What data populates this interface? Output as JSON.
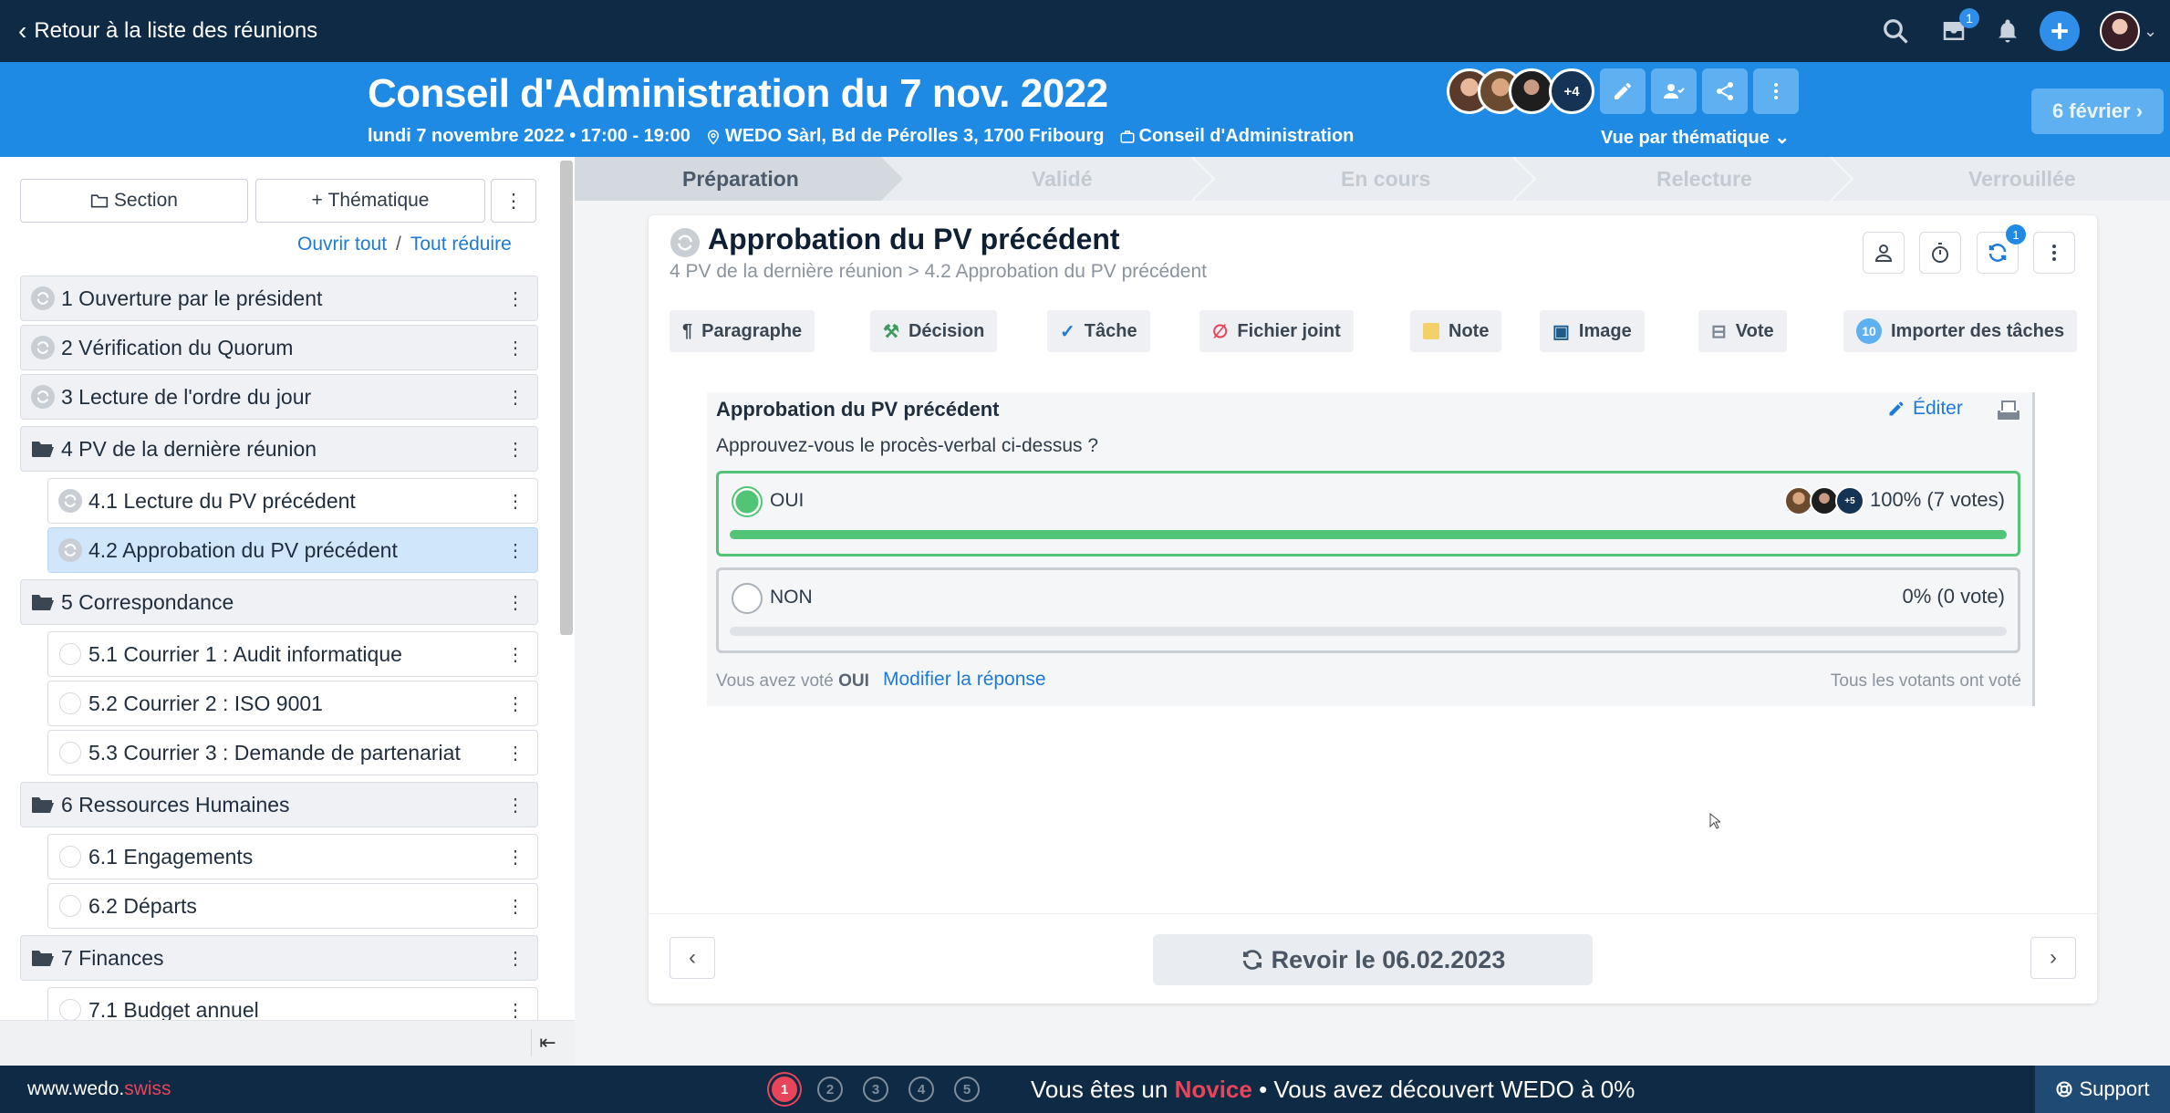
{
  "topbar": {
    "back_label": "Retour à la liste des réunions",
    "inbox_badge": "1"
  },
  "header": {
    "title": "Conseil d'Administration du 7 nov. 2022",
    "date_time": "lundi 7 novembre 2022 • 17:00 - 19:00",
    "location": "WEDO Sàrl, Bd de Pérolles 3, 1700 Fribourg",
    "group": "Conseil d'Administration",
    "extra_attendees": "+4",
    "view_mode": "Vue par thématique",
    "next_meeting": "6 février"
  },
  "sidebar": {
    "section_button": "Section",
    "theme_button": "Thématique",
    "open_all": "Ouvrir tout",
    "separator": "/",
    "collapse_all": "Tout réduire",
    "items": [
      {
        "label": "1 Ouverture par le président",
        "level": 1,
        "icon": "sync-icon"
      },
      {
        "label": "2 Vérification du Quorum",
        "level": 1,
        "icon": "sync-icon"
      },
      {
        "label": "3 Lecture de l'ordre du jour",
        "level": 1,
        "icon": "sync-icon"
      },
      {
        "label": "4 PV de la dernière réunion",
        "level": 1,
        "icon": "folder-open-icon"
      },
      {
        "label": "4.1 Lecture du PV précédent",
        "level": 2,
        "icon": "sync-icon"
      },
      {
        "label": "4.2 Approbation du PV précédent",
        "level": 2,
        "icon": "sync-icon",
        "selected": true
      },
      {
        "label": "5 Correspondance",
        "level": 1,
        "icon": "folder-open-icon"
      },
      {
        "label": "5.1 Courrier 1 : Audit informatique",
        "level": 2,
        "icon": "circle-icon"
      },
      {
        "label": "5.2 Courrier 2 : ISO 9001",
        "level": 2,
        "icon": "circle-icon"
      },
      {
        "label": "5.3 Courrier 3 : Demande de partenariat",
        "level": 2,
        "icon": "circle-icon"
      },
      {
        "label": "6 Ressources Humaines",
        "level": 1,
        "icon": "folder-open-icon"
      },
      {
        "label": "6.1 Engagements",
        "level": 2,
        "icon": "circle-icon"
      },
      {
        "label": "6.2 Départs",
        "level": 2,
        "icon": "circle-icon"
      },
      {
        "label": "7 Finances",
        "level": 1,
        "icon": "folder-open-icon"
      },
      {
        "label": "7.1 Budget annuel",
        "level": 2,
        "icon": "circle-icon"
      }
    ]
  },
  "stepper": {
    "steps": [
      "Préparation",
      "Validé",
      "En cours",
      "Relecture",
      "Verrouillée"
    ],
    "active": "Préparation"
  },
  "topic": {
    "title": "Approbation du PV précédent",
    "breadcrumb": "4 PV de la dernière réunion > 4.2 Approbation du PV précédent",
    "sync_badge": "1",
    "tools": {
      "paragraph": "Paragraphe",
      "decision": "Décision",
      "task": "Tâche",
      "file": "Fichier joint",
      "note": "Note",
      "image": "Image",
      "vote": "Vote",
      "import_count": "10",
      "import": "Importer des tâches"
    }
  },
  "vote": {
    "title": "Approbation du PV précédent",
    "edit_label": "Éditer",
    "question": "Approuvez-vous le procès-verbal ci-dessus ?",
    "options": [
      {
        "label": "OUI",
        "result": "100% (7 votes)",
        "share": 1.0,
        "selected": true,
        "extra_voters": "+5"
      },
      {
        "label": "NON",
        "result": "0% (0 vote)",
        "share": 0.0,
        "selected": false
      }
    ],
    "my_vote_prefix": "Vous avez voté",
    "my_vote_value": "OUI",
    "modify_label": "Modifier la réponse",
    "all_voted": "Tous les votants ont voté"
  },
  "footer": {
    "review_label": "Revoir le 06.02.2023"
  },
  "bottombar": {
    "site_main": "www.wedo.",
    "site_suffix": "swiss",
    "levels": [
      "1",
      "2",
      "3",
      "4",
      "5"
    ],
    "status_prefix": "Vous êtes un",
    "status_level": "Novice",
    "status_suffix": "• Vous avez découvert WEDO à 0%",
    "support_label": "Support"
  },
  "colors": {
    "topbar": "#0f2a44",
    "header": "#1e8ae4",
    "accent": "#1e7ad6",
    "success": "#52c476",
    "danger": "#e8455a"
  }
}
